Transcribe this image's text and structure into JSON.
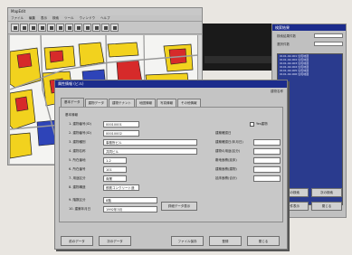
{
  "main_window": {
    "title": "MapEdit",
    "menu": [
      "ファイル",
      "編集",
      "表示",
      "検索",
      "ツール",
      "ウィンドウ",
      "ヘルプ"
    ]
  },
  "colors": {
    "title_bar": "#1c2c8c",
    "map_yellow": "#f2d21e",
    "map_red": "#d62a2a",
    "map_blue": "#2e44b8",
    "map_black": "#111111",
    "list_bg": "#2a3b8e"
  },
  "side_panel": {
    "title": "検索結果",
    "row1_label": "検索結果件数",
    "row2_label": "選択件数",
    "items": [
      "0101-02-001 住宅地図",
      "0101-02-002 住宅地図",
      "0101-02-003 住宅地図",
      "0101-02-004 住宅地図",
      "0101-02-005 住宅地図",
      "0101-02-006 住宅地図"
    ],
    "buttons": [
      "前の検索",
      "次の検索",
      "全件表示",
      "閉じる"
    ]
  },
  "dialog": {
    "title": "属性情報 (ビル)",
    "top_right": "建物名称",
    "tabs": [
      "基本データ",
      "建物データ",
      "建物テナント",
      "地図情報",
      "写真情報",
      "その他情報"
    ],
    "active_tab": 0,
    "group_label": "基本情報",
    "fields": [
      {
        "label": "1. 建物番号(ID)",
        "value": "00010001"
      },
      {
        "label": "2. 建物番号(ID)",
        "value": "00010002"
      },
      {
        "label": "3. 建物種別",
        "value": "事務所ビル"
      },
      {
        "label": "4. 建物名称",
        "value": "共同ビル"
      },
      {
        "label": "5. 所在番地",
        "value": "1-2"
      },
      {
        "label": "6. 所在番号",
        "value": "101"
      },
      {
        "label": "7. 用途区分",
        "value": "商業"
      },
      {
        "label": "8. 建物構造",
        "value": "鉄筋コンクリート造"
      },
      {
        "label": "9. 階数区分",
        "value": "8階"
      },
      {
        "label": "10. 建築年月日",
        "value": "1992年3月"
      }
    ],
    "checkbox_label": "Yes建物",
    "right_group_label": "建築確認日",
    "right_fields": [
      "建築確認日(年月日)",
      "建物の用途(区分)",
      "敷地面積(延床)",
      "建築面積(建物)",
      "延床面積(合計)"
    ],
    "mid_button": "詳細データ表示",
    "buttons": [
      "前のデータ",
      "次のデータ",
      "ファイル保存",
      "登録",
      "閉じる"
    ]
  }
}
